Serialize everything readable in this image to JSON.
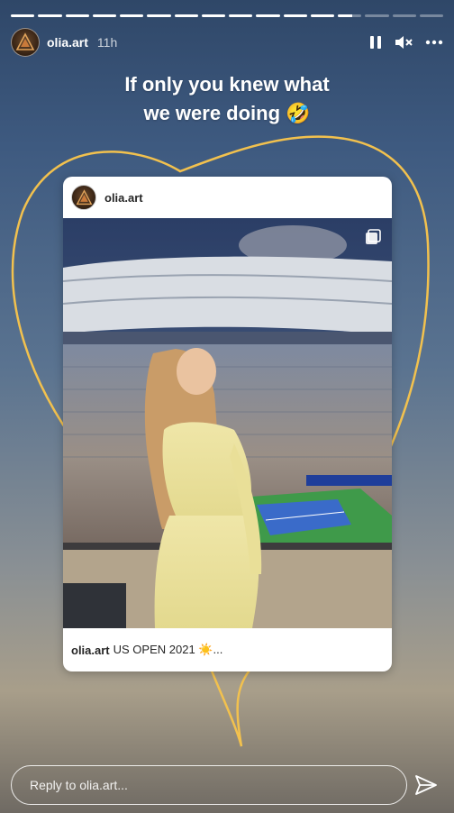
{
  "story": {
    "progress": [
      1,
      1,
      1,
      1,
      1,
      1,
      1,
      1,
      1,
      1,
      1,
      1,
      0.6,
      0,
      0,
      0
    ],
    "username": "olia.art",
    "time": "11h"
  },
  "caption": {
    "line1": "If only you knew what",
    "line2": "we were doing 🤣"
  },
  "post": {
    "username": "olia.art",
    "caption_user": "olia.art",
    "caption_text": "US OPEN 2021 ☀️..."
  },
  "reply": {
    "placeholder": "Reply to olia.art..."
  },
  "icons": {
    "pause": "pause-icon",
    "mute": "mute-icon",
    "more": "more-icon",
    "send": "send-icon",
    "carousel": "carousel-icon"
  },
  "colors": {
    "heart_stroke": "#f2c14e",
    "accent_white": "#ffffff"
  }
}
